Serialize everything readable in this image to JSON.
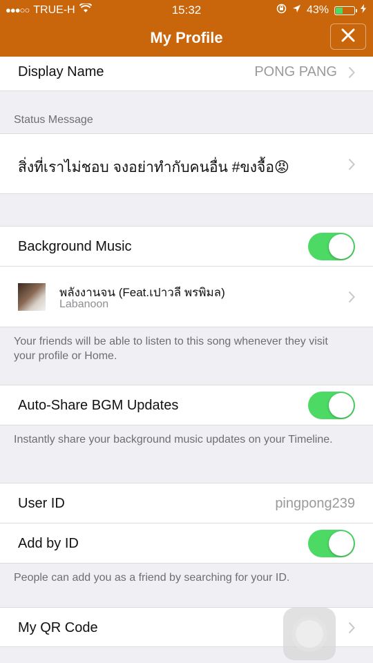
{
  "status_bar": {
    "signal": "●●●○○",
    "carrier": "TRUE-H",
    "time": "15:32",
    "battery_percent": "43%",
    "battery_level": 0.43
  },
  "nav": {
    "title": "My Profile",
    "close_icon": "close-icon"
  },
  "display_name": {
    "label": "Display Name",
    "value": "PONG PANG"
  },
  "status_message": {
    "header": "Status Message",
    "text": "สิ่งที่เราไม่ชอบ จงอย่าทำกับคนอื่น #ขงจื้อ",
    "emoji": "😡"
  },
  "background_music": {
    "label": "Background Music",
    "enabled": true,
    "song_title": "พลังงานจน (Feat.เปาวลี พรพิมล)",
    "song_artist": "Labanoon",
    "footer": "Your friends will be able to listen to this song whenever they visit your profile or Home."
  },
  "auto_share": {
    "label": "Auto-Share BGM Updates",
    "enabled": true,
    "footer": "Instantly share your background music updates on your Timeline."
  },
  "user_id": {
    "label": "User ID",
    "value": "pingpong239"
  },
  "add_by_id": {
    "label": "Add by ID",
    "enabled": true,
    "footer": "People can add you as a friend by searching for your ID."
  },
  "qr_code": {
    "label": "My QR Code"
  },
  "colors": {
    "accent": "#c9660c",
    "toggle_on": "#4cd964",
    "background": "#efeff4"
  }
}
